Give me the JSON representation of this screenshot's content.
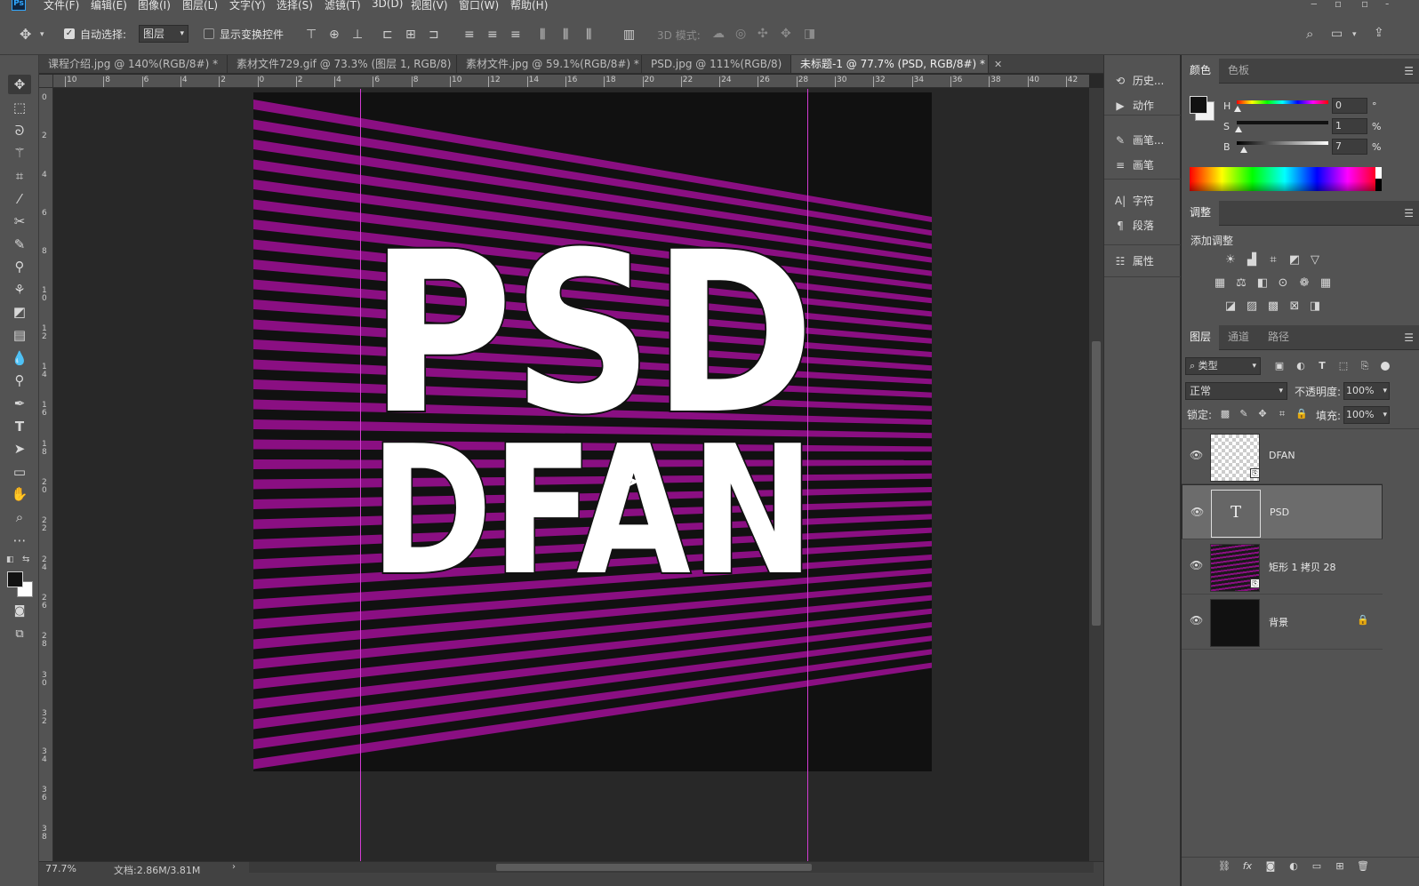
{
  "app": {
    "logo": "Ps"
  },
  "menu": [
    "文件(F)",
    "编辑(E)",
    "图像(I)",
    "图层(L)",
    "文字(Y)",
    "选择(S)",
    "滤镜(T)",
    "3D(D)",
    "视图(V)",
    "窗口(W)",
    "帮助(H)"
  ],
  "options": {
    "auto_select_label": "自动选择:",
    "auto_select_checked": true,
    "auto_select_value": "图层",
    "show_transform_label": "显示变换控件",
    "mode_3d_label": "3D 模式:"
  },
  "tabs": [
    {
      "label": "课程介绍.jpg @ 140%(RGB/8#) *",
      "active": false
    },
    {
      "label": "素材文件729.gif @ 73.3% (图层 1, RGB/8)",
      "active": false
    },
    {
      "label": "素材文件.jpg @ 59.1%(RGB/8#) *",
      "active": false
    },
    {
      "label": "PSD.jpg @ 111%(RGB/8)",
      "active": false
    },
    {
      "label": "未标题-1 @ 77.7% (PSD, RGB/8#) *",
      "active": true
    }
  ],
  "ruler": {
    "h_labels": [
      "10",
      "8",
      "6",
      "4",
      "2",
      "0",
      "2",
      "4",
      "6",
      "8",
      "10",
      "12",
      "14",
      "16",
      "18",
      "20",
      "22",
      "24",
      "26",
      "28",
      "30",
      "32",
      "34",
      "36",
      "38",
      "40",
      "42"
    ],
    "v_labels": [
      "0",
      "2",
      "4",
      "6",
      "8",
      "1 0",
      "1 2",
      "1 4",
      "1 6",
      "1 8",
      "2 0",
      "2 2",
      "2 4",
      "2 6",
      "2 8",
      "3 0",
      "3 2",
      "3 4",
      "3 6",
      "3 8"
    ]
  },
  "artwork": {
    "line1": "PSD",
    "line2": "DFAN",
    "bg_color": "#111111",
    "stripe_color": "#8a0f82",
    "text_color": "#ffffff",
    "guide_color": "#d23cd2"
  },
  "status": {
    "zoom": "77.7%",
    "doc": "文档:2.86M/3.81M"
  },
  "dock": [
    {
      "icon": "history-icon",
      "glyph": "⟲",
      "label": "历史..."
    },
    {
      "icon": "actions-icon",
      "glyph": "▶",
      "label": "动作"
    },
    {
      "icon": "brush-presets-icon",
      "glyph": "✎",
      "label": "画笔..."
    },
    {
      "icon": "brush-icon",
      "glyph": "≡",
      "label": "画笔"
    },
    {
      "icon": "character-icon",
      "glyph": "A|",
      "label": "字符"
    },
    {
      "icon": "paragraph-icon",
      "glyph": "¶",
      "label": "段落"
    },
    {
      "icon": "properties-icon",
      "glyph": "☷",
      "label": "属性"
    }
  ],
  "color_panel": {
    "tabs": [
      "颜色",
      "色板"
    ],
    "h_label": "H",
    "s_label": "S",
    "b_label": "B",
    "h_value": "0",
    "s_value": "1",
    "b_value": "7",
    "h_unit": "°",
    "s_unit": "%",
    "b_unit": "%",
    "h_level": 0,
    "s_level": 0.01,
    "b_level": 0.07
  },
  "adjust_panel": {
    "tab": "调整",
    "subtitle": "添加调整"
  },
  "layers_panel": {
    "tabs": [
      "图层",
      "通道",
      "路径"
    ],
    "filter_value": "类型",
    "blend_mode": "正常",
    "opacity_label": "不透明度:",
    "opacity_value": "100%",
    "lock_label": "锁定:",
    "fill_label": "填充:",
    "fill_value": "100%",
    "layers": [
      {
        "name": "DFAN",
        "type": "smart",
        "selected": false
      },
      {
        "name": "PSD",
        "type": "text",
        "selected": true
      },
      {
        "name": "矩形 1 拷贝 28",
        "type": "stripes",
        "selected": false
      },
      {
        "name": "背景",
        "type": "background",
        "selected": false,
        "locked": true
      }
    ]
  }
}
